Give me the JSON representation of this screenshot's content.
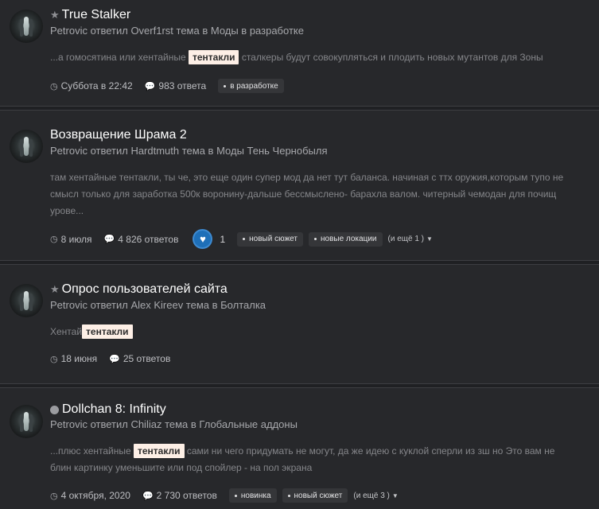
{
  "results": [
    {
      "title": "True Stalker",
      "title_icon": "star-icon",
      "meta_line": "Petrovic ответил Overf1rst тема в Моды в разработке",
      "snippet_before": "...а гомосятина или хентайные ",
      "snippet_highlight": "тентакли",
      "snippet_after": " сталкеры будут совокупляться и плодить новых мутантов для Зоны",
      "date": "Суббота в 22:42",
      "replies": "983 ответа",
      "tags": [
        "в разработке"
      ]
    },
    {
      "title": "Возвращение Шрама 2",
      "meta_line": "Petrovic ответил Hardtmuth тема в Моды Тень Чернобыля",
      "snippet_lines": [
        "там хентайные тентакли, ты че, это еще один супер мод да нет тут баланса. начиная с ттх оружия,которым тупо не",
        "смысл только для заработка 500к воронину-дальше бессмыслено- барахла валом. читерный чемодан для почищ",
        "урове..."
      ],
      "date": "8 июля",
      "replies": "4 826 ответов",
      "likes": "1",
      "tags": [
        "новый сюжет",
        "новые локации"
      ],
      "more": "(и ещё 1 )"
    },
    {
      "title": "Опрос пользователей сайта",
      "title_icon": "star-icon",
      "meta_line": "Petrovic ответил Alex Kireev тема в Болталка",
      "snippet_before": "Хентай",
      "snippet_highlight": "тентакли",
      "date": "18 июня",
      "replies": "25 ответов"
    },
    {
      "title": "Dollchan 8: Infinity",
      "title_icon": "circle-icon",
      "meta_line": "Petrovic ответил Chiliaz тема в Глобальные аддоны",
      "snippet_before": "...плюс хентайные ",
      "snippet_highlight": "тентакли",
      "snippet_after": " сами ни чего придумать не могут, да же идею с куклой сперли из зш но Это вам не",
      "snippet_line2": "блин картинку уменьшите или под спойлер - на пол экрана",
      "date": "4 октября, 2020",
      "replies": "2 730 ответов",
      "tags": [
        "новинка",
        "новый сюжет"
      ],
      "more": "(и ещё 3 )"
    }
  ]
}
